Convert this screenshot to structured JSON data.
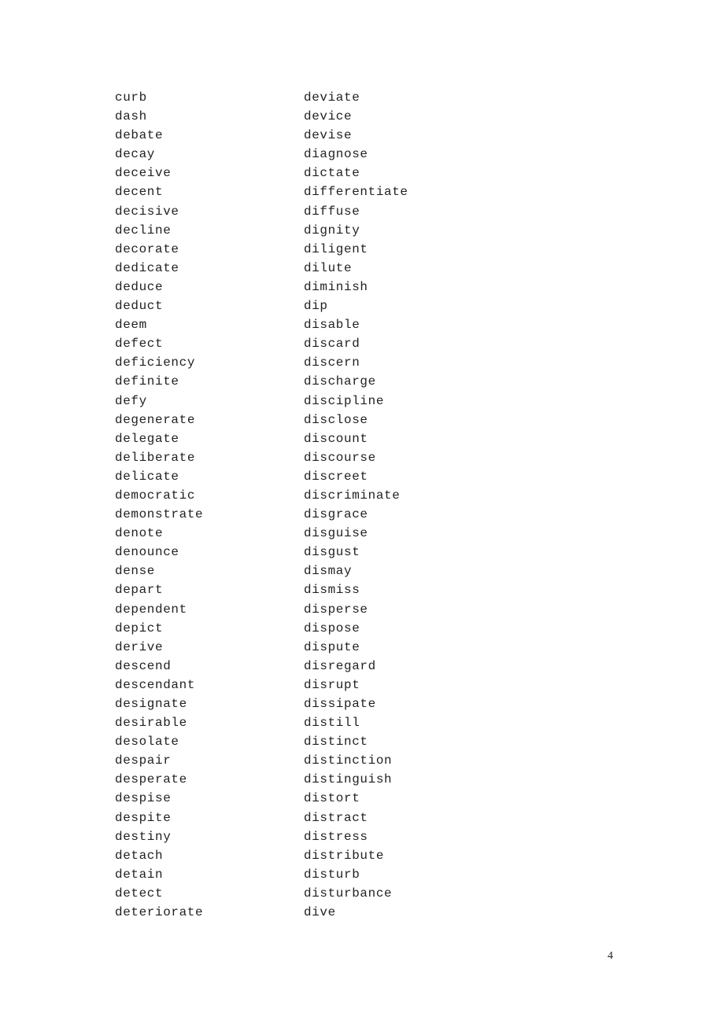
{
  "document": {
    "columns": [
      {
        "words": [
          "curb",
          "dash",
          "debate",
          "decay",
          "deceive",
          "decent",
          "decisive",
          "decline",
          "decorate",
          "dedicate",
          "deduce",
          "deduct",
          "deem",
          "defect",
          "deficiency",
          "definite",
          "defy",
          "degenerate",
          "delegate",
          "deliberate",
          "delicate",
          "democratic",
          "demonstrate",
          "denote",
          "denounce",
          "dense",
          "depart",
          "dependent",
          "depict",
          "derive",
          "descend",
          "descendant",
          "designate",
          "desirable",
          "desolate",
          "despair",
          "desperate",
          "despise",
          "despite",
          "destiny",
          "detach",
          "detain",
          "detect",
          "deteriorate"
        ]
      },
      {
        "words": [
          "deviate",
          "device",
          "devise",
          "diagnose",
          "dictate",
          "differentiate",
          "diffuse",
          "dignity",
          "diligent",
          "dilute",
          "diminish",
          "dip",
          "disable",
          "discard",
          "discern",
          "discharge",
          "discipline",
          "disclose",
          "discount",
          "discourse",
          "discreet",
          "discriminate",
          "disgrace",
          "disguise",
          "disgust",
          "dismay",
          "dismiss",
          "disperse",
          "dispose",
          "dispute",
          "disregard",
          "disrupt",
          "dissipate",
          "distill",
          "distinct",
          "distinction",
          "distinguish",
          "distort",
          "distract",
          "distress",
          "distribute",
          "disturb",
          "disturbance",
          "dive"
        ]
      }
    ],
    "page_number": "4"
  }
}
